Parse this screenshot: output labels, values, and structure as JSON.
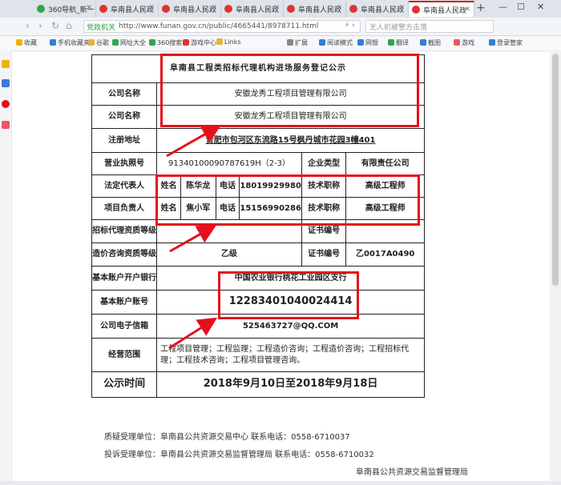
{
  "browser": {
    "tabs": [
      {
        "label": "360导航_新一"
      },
      {
        "label": "阜南县人民政"
      },
      {
        "label": "阜南县人民政"
      },
      {
        "label": "阜南县人民政"
      },
      {
        "label": "阜南县人民政"
      },
      {
        "label": "阜南县人民政"
      },
      {
        "label": "阜南县人民政"
      }
    ],
    "secure_label": "党政机关",
    "url": "http://www.funan.gov.cn/public/4665441/8978711.html",
    "search_placeholder": "无人机被警方击落",
    "new_tab": "+",
    "bookmarks": [
      "收藏",
      "手机收藏夹",
      "谷歌",
      "网址大全",
      "360搜索",
      "游戏中心",
      "Links",
      "扩展",
      "阅读模式",
      "网银",
      "翻译",
      "截图",
      "游戏",
      "登录管家"
    ],
    "brand_color": "#2fa74b"
  },
  "notice": {
    "title": "阜南县工程类招标代理机构进场服务登记公示",
    "rows": {
      "company_label_1": "公司名称",
      "company_value_1": "安徽龙秀工程项目管理有限公司",
      "company_label_2": "公司名称",
      "company_value_2": "安徽龙秀工程项目管理有限公司",
      "address_label": "注册地址",
      "address_value": "合肥市包河区东流路15号枫丹城市花园3幢401",
      "license_label": "营业执照号",
      "license_value": "91340100090787619H（2-3）",
      "type_label": "企业类型",
      "type_value": "有限责任公司",
      "legal_label": "法定代表人",
      "name_label": "姓名",
      "legal_name": "陈华龙",
      "phone_label": "电话",
      "legal_phone": "18019929980",
      "title_label": "技术职称",
      "legal_title": "高级工程师",
      "pm_label": "项目负责人",
      "pm_name": "焦小军",
      "pm_phone": "15156990286",
      "pm_title": "高级工程师",
      "bid_qual_label": "招标代理资质等级",
      "cert_label": "证书编号",
      "cost_qual_label": "造价咨询资质等级",
      "cost_qual_value": "乙级",
      "cost_cert_value": "乙0017A0490",
      "bank_label": "基本账户开户银行",
      "bank_value": "中国农业银行桃花工业园区支行",
      "account_label": "基本账户账号",
      "account_value": "12283401040024414",
      "email_label": "公司电子信箱",
      "email_value": "525463727@QQ.COM",
      "scope_label": "经营范围",
      "scope_value": "工程项目管理；工程监理；工程造价咨询；工程造价咨询；工程招标代理；工程技术咨询；工程项目管理咨询。",
      "period_label": "公示时间",
      "period_value": "2018年9月10日至2018年9月18日"
    },
    "footer": {
      "inquiry": "质疑受理单位：阜南县公共资源交易中心 联系电话：0558-6710037",
      "complaint": "投诉受理单位：阜南县公共资源交易监督管理局 联系电话：0558-6710032",
      "issuer": "阜南县公共资源交易监督管理局"
    },
    "highlight_color": "#e4111c"
  }
}
